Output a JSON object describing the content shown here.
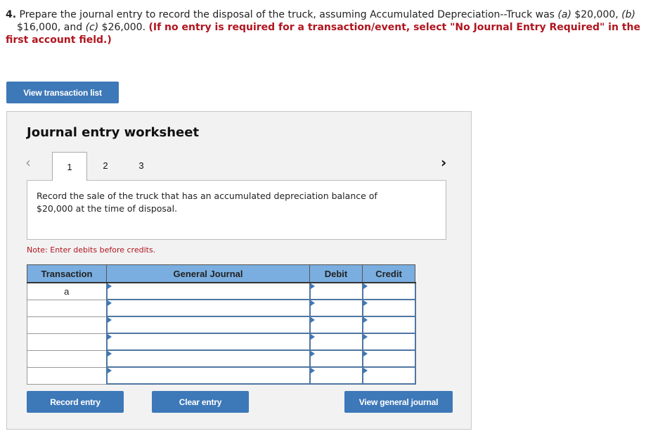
{
  "question": {
    "number": "4.",
    "text_part1": "Prepare the journal entry to record the disposal of the truck, assuming Accumulated Depreciation--Truck was ",
    "label_a": "(a)",
    "amount_a": " $20,000, ",
    "label_b": "(b)",
    "amount_b": " $16,000, and ",
    "label_c": "(c)",
    "amount_c": " $26,000. ",
    "instruction": "(If no entry is required for a transaction/event, select \"No Journal Entry Required\" in the first account field.)"
  },
  "buttons": {
    "view_transaction_list": "View transaction list",
    "record_entry": "Record entry",
    "clear_entry": "Clear entry",
    "view_general_journal": "View general journal"
  },
  "worksheet": {
    "title": "Journal entry worksheet",
    "nav_prev": "<",
    "nav_next": ">",
    "tabs": [
      {
        "label": "1",
        "active": true
      },
      {
        "label": "2",
        "active": false
      },
      {
        "label": "3",
        "active": false
      }
    ],
    "description": "Record the sale of the truck that has an accumulated depreciation balance of $20,000 at the time of disposal.",
    "note": "Note: Enter debits before credits."
  },
  "journal_table": {
    "headers": {
      "transaction": "Transaction",
      "general_journal": "General Journal",
      "debit": "Debit",
      "credit": "Credit"
    },
    "rows": [
      {
        "transaction": "a",
        "account": "",
        "debit": "",
        "credit": ""
      },
      {
        "transaction": "",
        "account": "",
        "debit": "",
        "credit": ""
      },
      {
        "transaction": "",
        "account": "",
        "debit": "",
        "credit": ""
      },
      {
        "transaction": "",
        "account": "",
        "debit": "",
        "credit": ""
      },
      {
        "transaction": "",
        "account": "",
        "debit": "",
        "credit": ""
      },
      {
        "transaction": "",
        "account": "",
        "debit": "",
        "credit": ""
      }
    ]
  },
  "colors": {
    "button_blue": "#3d78b8",
    "header_blue": "#7aaee0",
    "instruction_red": "#b0151f",
    "panel_gray": "#f2f2f2"
  }
}
